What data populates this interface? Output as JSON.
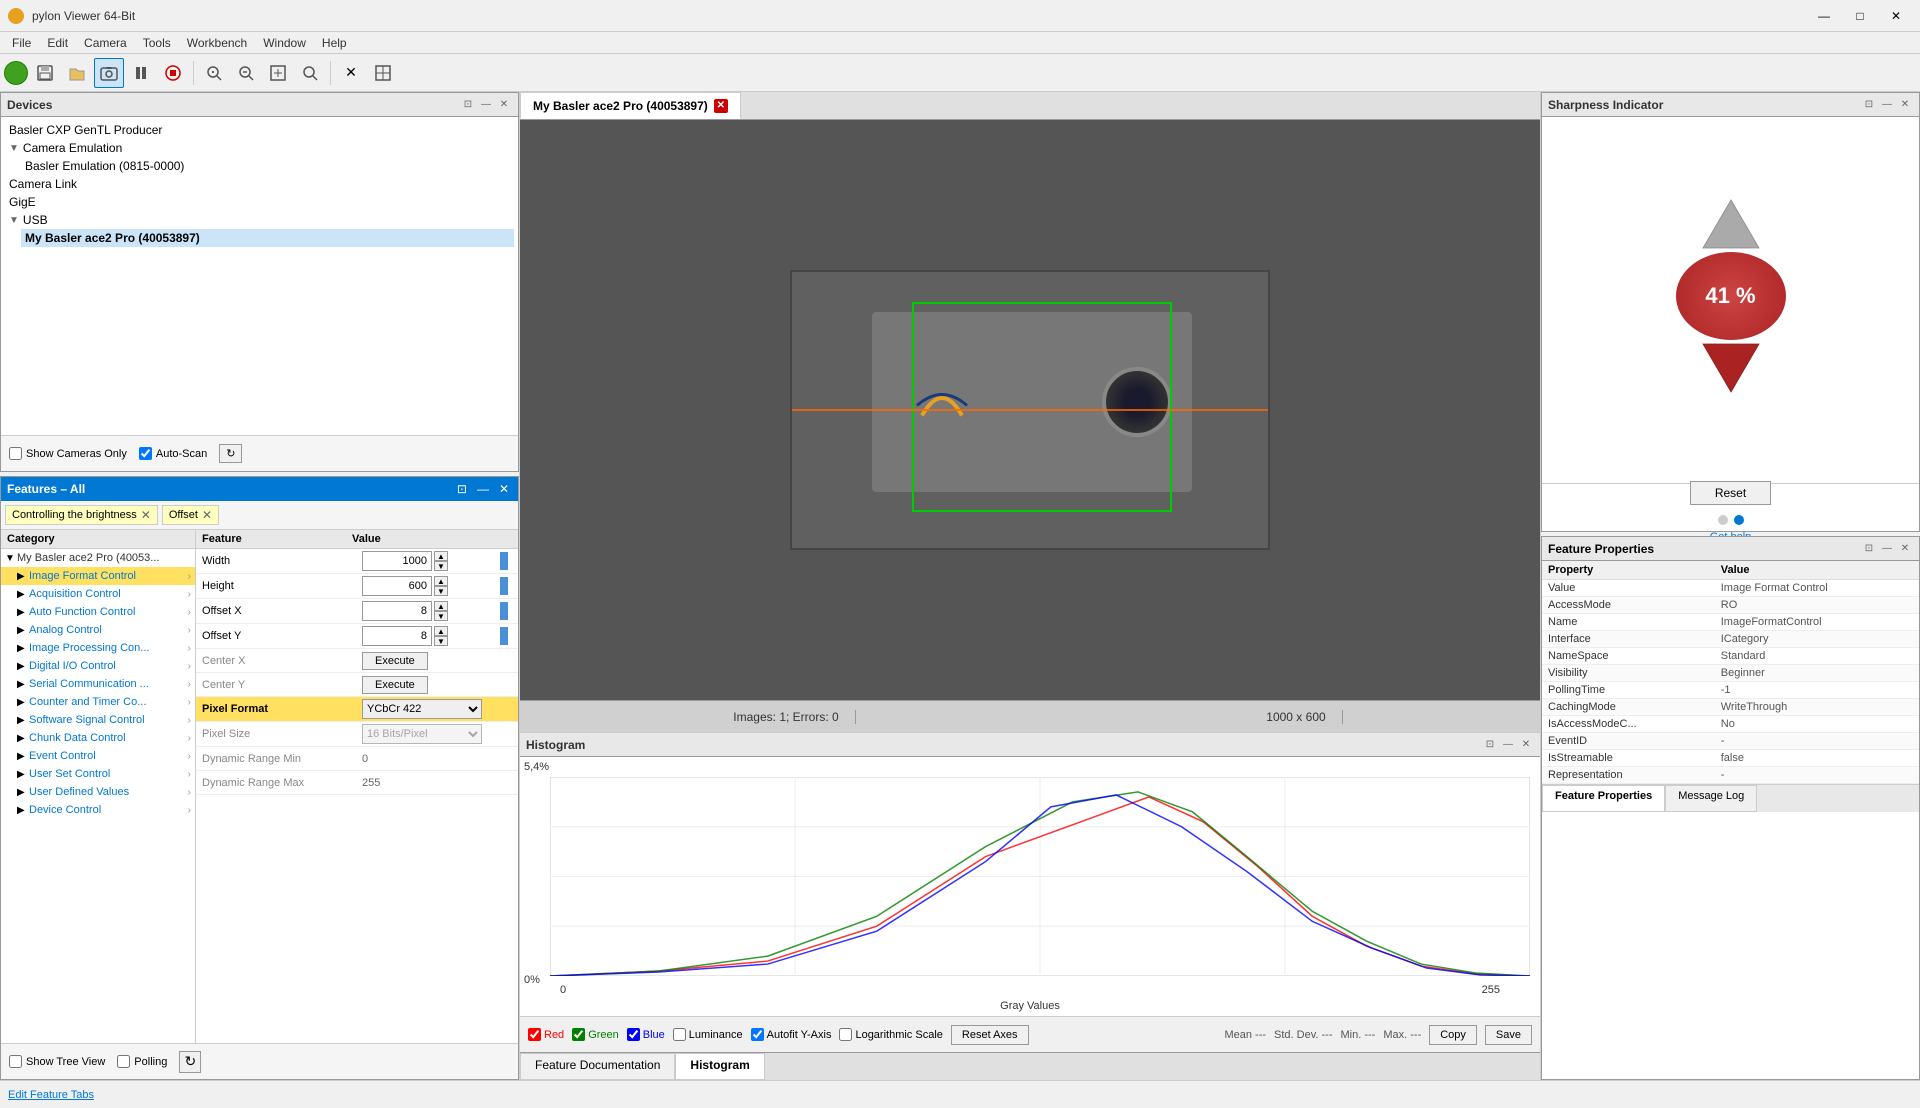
{
  "app": {
    "title": "pylon Viewer 64-Bit",
    "icon": "camera-icon"
  },
  "titlebar": {
    "minimize": "—",
    "maximize": "□",
    "close": "✕"
  },
  "menu": {
    "items": [
      "File",
      "Edit",
      "Camera",
      "Tools",
      "Workbench",
      "Window",
      "Help"
    ]
  },
  "toolbar": {
    "buttons": [
      "⏺",
      "📷",
      "📷",
      "📋",
      "⏸",
      "⏹",
      "🔍+",
      "🔍-",
      "🔍",
      "🔍",
      "✕",
      "⊕",
      "⊞",
      "📈",
      "📌",
      "🖼",
      "⚙"
    ]
  },
  "devices": {
    "panel_title": "Devices",
    "tree": [
      {
        "label": "Basler CXP GenTL Producer",
        "indent": 0
      },
      {
        "label": "Camera Emulation",
        "indent": 0,
        "expanded": true
      },
      {
        "label": "Basler Emulation (0815-0000)",
        "indent": 1
      },
      {
        "label": "Camera Link",
        "indent": 0
      },
      {
        "label": "GigE",
        "indent": 0
      },
      {
        "label": "USB",
        "indent": 0,
        "expanded": true
      },
      {
        "label": "My Basler ace2 Pro (40053897)",
        "indent": 1,
        "selected": true
      }
    ],
    "show_cameras_only": "Show Cameras Only",
    "auto_scan": "Auto-Scan"
  },
  "features": {
    "panel_title": "Features – All",
    "filter1": "Controlling the brightness",
    "filter2": "Offset",
    "col_category": "Category",
    "col_feature": "Feature",
    "col_value": "Value",
    "tree_root": "My Basler ace2 Pro (40053...",
    "categories": [
      {
        "label": "Image Format Control",
        "selected": false,
        "level": 1
      },
      {
        "label": "Acquisition Control",
        "selected": false,
        "level": 1
      },
      {
        "label": "Auto Function Control",
        "selected": false,
        "level": 1
      },
      {
        "label": "Analog Control",
        "selected": false,
        "level": 1
      },
      {
        "label": "Image Processing Con...",
        "selected": false,
        "level": 1
      },
      {
        "label": "Digital I/O Control",
        "selected": false,
        "level": 1
      },
      {
        "label": "Serial Communication ...",
        "selected": false,
        "level": 1
      },
      {
        "label": "Counter and Timer Co...",
        "selected": false,
        "level": 1
      },
      {
        "label": "Software Signal Control",
        "selected": false,
        "level": 1
      },
      {
        "label": "Chunk Data Control",
        "selected": false,
        "level": 1
      },
      {
        "label": "Event Control",
        "selected": false,
        "level": 1
      },
      {
        "label": "User Set Control",
        "selected": false,
        "level": 1
      },
      {
        "label": "User Defined Values",
        "selected": false,
        "level": 1
      },
      {
        "label": "Device Control",
        "selected": false,
        "level": 1
      }
    ],
    "features_rows": [
      {
        "name": "Width",
        "value": "1000",
        "type": "spinner",
        "bar": true
      },
      {
        "name": "Height",
        "value": "600",
        "type": "spinner",
        "bar": true
      },
      {
        "name": "Offset X",
        "value": "8",
        "type": "spinner",
        "bar": true
      },
      {
        "name": "Offset Y",
        "value": "8",
        "type": "spinner",
        "bar": true
      },
      {
        "name": "Center X",
        "value": "",
        "type": "execute"
      },
      {
        "name": "Center Y",
        "value": "",
        "type": "execute"
      },
      {
        "name": "Pixel Format",
        "value": "YCbCr 422",
        "type": "select",
        "selected": true
      },
      {
        "name": "Pixel Size",
        "value": "16 Bits/Pixel",
        "type": "select_disabled"
      },
      {
        "name": "Dynamic Range Min",
        "value": "0",
        "type": "static"
      },
      {
        "name": "Dynamic Range Max",
        "value": "255",
        "type": "static"
      }
    ],
    "show_tree_view": "Show Tree View",
    "polling": "Polling"
  },
  "image_viewer": {
    "tab_title": "My Basler ace2 Pro (40053897)",
    "status_images": "Images: 1; Errors: 0",
    "status_resolution": "1000 x 600"
  },
  "histogram": {
    "panel_title": "Histogram",
    "y_max": "5,4%",
    "y_min": "0%",
    "x_min": "0",
    "x_max": "255",
    "x_label": "Gray Values",
    "checkboxes": [
      {
        "label": "Red",
        "color": "red",
        "checked": true
      },
      {
        "label": "Green",
        "color": "green",
        "checked": true
      },
      {
        "label": "Blue",
        "color": "blue",
        "checked": true
      },
      {
        "label": "Luminance",
        "color": "gray",
        "checked": false
      }
    ],
    "autofit_y": "Autofit Y-Axis",
    "log_scale": "Logarithmic Scale",
    "reset_axes": "Reset Axes",
    "stats": {
      "mean": "Mean ---",
      "std_dev": "Std. Dev. ---",
      "min": "Min. ---",
      "max": "Max. ---"
    },
    "copy_btn": "Copy",
    "save_btn": "Save"
  },
  "bottom_tabs": [
    {
      "label": "Feature Documentation",
      "active": false
    },
    {
      "label": "Histogram",
      "active": true
    }
  ],
  "sharpness": {
    "panel_title": "Sharpness Indicator",
    "value": "41 %",
    "reset_btn": "Reset",
    "get_help": "Get help"
  },
  "feature_props": {
    "panel_title": "Feature Properties",
    "col_property": "Property",
    "col_value": "Value",
    "rows": [
      {
        "property": "Value",
        "value": "Image Format Control"
      },
      {
        "property": "AccessMode",
        "value": "RO"
      },
      {
        "property": "Name",
        "value": "ImageFormatControl"
      },
      {
        "property": "Interface",
        "value": "ICategory"
      },
      {
        "property": "NameSpace",
        "value": "Standard"
      },
      {
        "property": "Visibility",
        "value": "Beginner"
      },
      {
        "property": "PollingTime",
        "value": "-1"
      },
      {
        "property": "CachingMode",
        "value": "WriteThrough"
      },
      {
        "property": "IsAccessModeC...",
        "value": "No"
      },
      {
        "property": "EventID",
        "value": "-"
      },
      {
        "property": "IsStreamable",
        "value": "false"
      },
      {
        "property": "Representation",
        "value": "-"
      }
    ],
    "tabs": [
      "Feature Properties",
      "Message Log"
    ]
  },
  "status_bar": {
    "edit_feature_tabs": "Edit Feature Tabs"
  }
}
